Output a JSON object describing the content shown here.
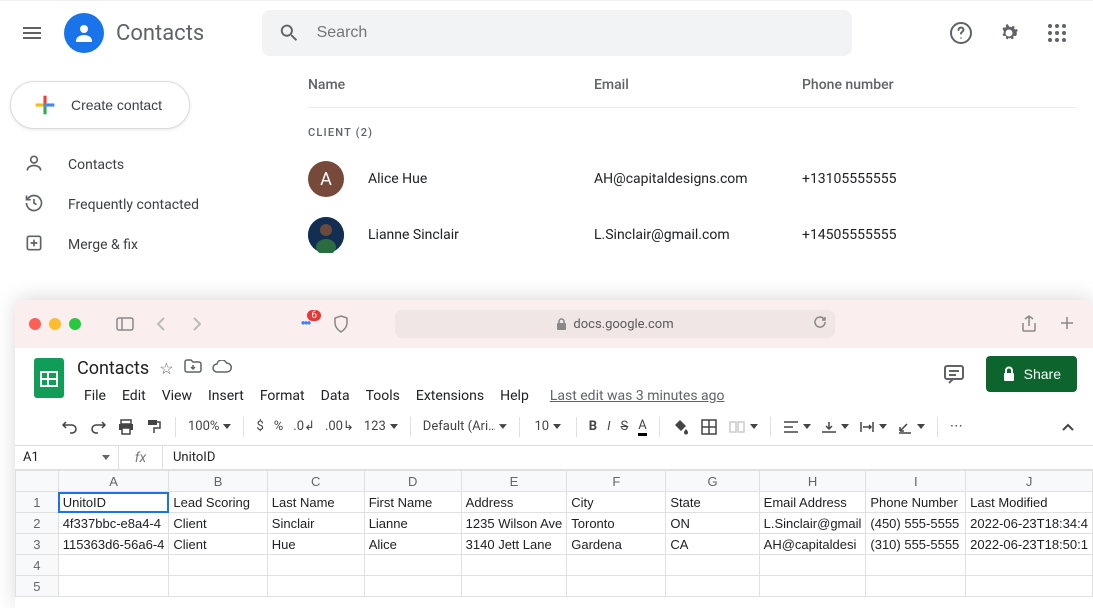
{
  "contacts": {
    "app_title": "Contacts",
    "search_placeholder": "Search",
    "create_label": "Create contact",
    "nav": [
      {
        "label": "Contacts"
      },
      {
        "label": "Frequently contacted"
      },
      {
        "label": "Merge & fix"
      }
    ],
    "columns": {
      "name": "Name",
      "email": "Email",
      "phone": "Phone number"
    },
    "group_label": "CLIENT (2)",
    "rows": [
      {
        "initial": "A",
        "name": "Alice Hue",
        "email": "AH@capitaldesigns.com",
        "phone": "+13105555555",
        "avatar_bg": "#76493b",
        "avatar_type": "initial"
      },
      {
        "initial": "",
        "name": "Lianne Sinclair",
        "email": "L.Sinclair@gmail.com",
        "phone": "+14505555555",
        "avatar_bg": "#122f53",
        "avatar_type": "photo"
      }
    ]
  },
  "browser": {
    "url": "docs.google.com",
    "notif_count": "6"
  },
  "sheets": {
    "doc_title": "Contacts",
    "menus": [
      "File",
      "Edit",
      "View",
      "Insert",
      "Format",
      "Data",
      "Tools",
      "Extensions",
      "Help"
    ],
    "last_edit": "Last edit was 3 minutes ago",
    "share_label": "Share",
    "toolbar": {
      "zoom": "100%",
      "font": "Default (Ari…",
      "size": "10"
    },
    "name_box": "A1",
    "formula_bar": "UnitoID",
    "col_headers": [
      "A",
      "B",
      "C",
      "D",
      "E",
      "F",
      "G",
      "H",
      "I",
      "J"
    ],
    "row_headers": [
      "1",
      "2",
      "3",
      "4",
      "5"
    ],
    "cells": [
      [
        "UnitoID",
        "Lead Scoring",
        "Last Name",
        "First Name",
        "Address",
        "City",
        "State",
        "Email Address",
        "Phone Number",
        "Last Modified"
      ],
      [
        "4f337bbc-e8a4-4",
        "Client",
        "Sinclair",
        "Lianne",
        "1235 Wilson Ave",
        "Toronto",
        "ON",
        "L.Sinclair@gmail",
        "(450) 555-5555",
        "2022-06-23T18:34:4"
      ],
      [
        "115363d6-56a6-4",
        "Client",
        "Hue",
        "Alice",
        "3140 Jett Lane",
        "Gardena",
        "CA",
        "AH@capitaldesi",
        "(310) 555-5555",
        "2022-06-23T18:50:1"
      ],
      [
        "",
        "",
        "",
        "",
        "",
        "",
        "",
        "",
        "",
        ""
      ],
      [
        "",
        "",
        "",
        "",
        "",
        "",
        "",
        "",
        "",
        ""
      ]
    ]
  }
}
